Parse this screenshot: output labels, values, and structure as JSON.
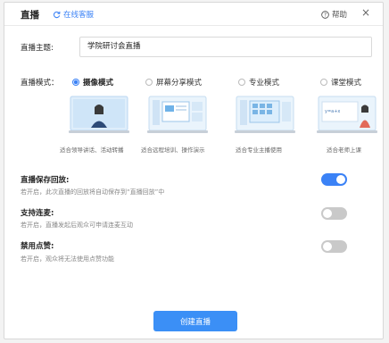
{
  "header": {
    "title": "直播",
    "support_label": "在线客服",
    "help_label": "帮助",
    "close_glyph": "×"
  },
  "topic": {
    "label": "直播主题:",
    "value": "学院研讨会直播"
  },
  "mode": {
    "label": "直播模式：",
    "options": [
      {
        "label": "摄像模式",
        "caption": "适合领导讲话、活动转播",
        "selected": true
      },
      {
        "label": "屏幕分享模式",
        "caption": "适合远程培训、操作演示",
        "selected": false
      },
      {
        "label": "专业模式",
        "caption": "适合专业主播使用",
        "selected": false
      },
      {
        "label": "课堂模式",
        "caption": "适合老师上课",
        "selected": false
      }
    ]
  },
  "settings": [
    {
      "title": "直播保存回放:",
      "desc": "若开启，此次直播的回放将自动保存到“直播回放”中",
      "enabled": true
    },
    {
      "title": "支持连麦:",
      "desc": "若开启，直播发起后观众可申请连麦互动",
      "enabled": false
    },
    {
      "title": "禁用点赞:",
      "desc": "若开启，观众将无法使用点赞功能",
      "enabled": false
    }
  ],
  "create_button": "创建直播",
  "colors": {
    "accent": "#3b82f6",
    "toggle_off": "#c9c9c9"
  }
}
